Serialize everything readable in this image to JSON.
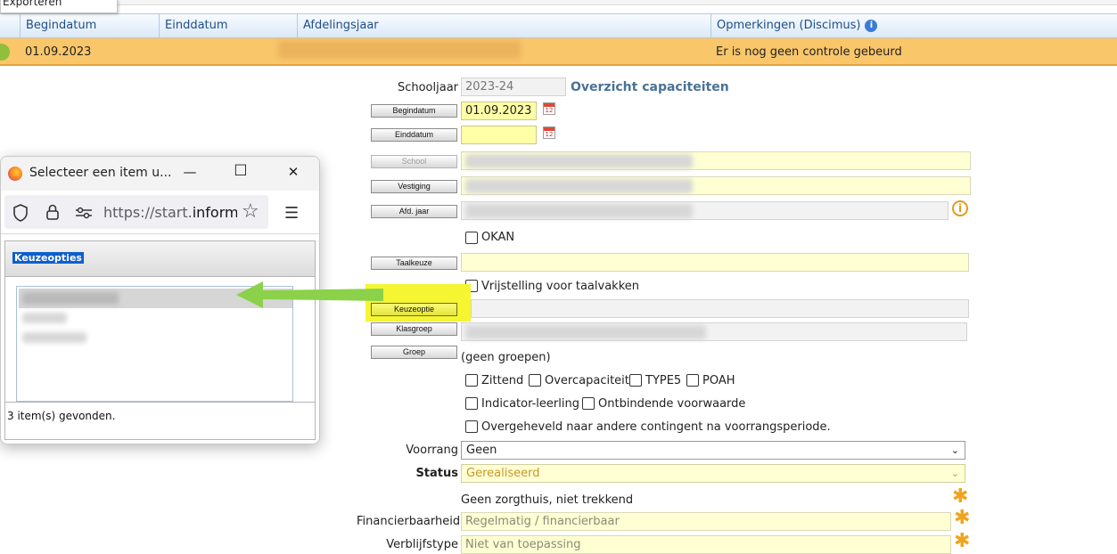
{
  "export_menu": {
    "item": "Exporteren"
  },
  "grid": {
    "columns": [
      "Begindatum",
      "Einddatum",
      "Afdelingsjaar",
      "Opmerkingen (Discimus)"
    ],
    "info_icon": "i",
    "row": {
      "begindatum": "01.09.2023",
      "einddatum": "",
      "opmerking": "Er is nog geen controle gebeurd"
    }
  },
  "form": {
    "schooljaar_label": "Schooljaar",
    "schooljaar_value": "2023-24",
    "overzicht_link": "Overzicht capaciteiten",
    "buttons": {
      "begindatum": "Begindatum",
      "einddatum": "Einddatum",
      "school": "School",
      "vestiging": "Vestiging",
      "afd_jaar": "Afd. jaar",
      "taalkeuze": "Taalkeuze",
      "keuzeoptie": "Keuzeoptie",
      "klasgroep": "Klasgroep",
      "groep": "Groep"
    },
    "begindatum_value": "01.09.2023",
    "einddatum_value": "",
    "cal_icon": "12",
    "okan_label": "OKAN",
    "vrijstelling_label": "Vrijstelling voor taalvakken",
    "geen_groepen": "(geen groepen)",
    "checkboxes_row1": [
      "Zittend",
      "Overcapaciteit",
      "TYPE5",
      "POAH"
    ],
    "checkboxes_row2": [
      "Indicator-leerling",
      "Ontbindende voorwaarde"
    ],
    "overgeheveld_label": "Overgeheveld naar andere contingent na voorrangsperiode.",
    "voorrang_label": "Voorrang",
    "voorrang_value": "Geen",
    "status_label": "Status",
    "status_value": "Gerealiseerd",
    "zorg_text": "Geen zorgthuis, niet trekkend",
    "financierbaarheid_label": "Financierbaarheid",
    "financierbaarheid_value": "Regelmatig / financierbaar",
    "verblijfstype_label": "Verblijfstype",
    "verblijfstype_value": "Niet van toepassing",
    "warn_icon": "i",
    "asterisk": "✱",
    "chevron": "⌄"
  },
  "popup": {
    "title": "Selecteer een item u...",
    "url_prefix": "https://start.",
    "url_domain": "informa",
    "min": "—",
    "max": "☐",
    "close": "✕",
    "panel_title": "Keuzeopties",
    "count_text": "3 item(s) gevonden.",
    "menu_icon": "☰",
    "star_icon": "☆"
  },
  "colors": {
    "row_highlight": "#f9c66a",
    "header_text": "#1f4e89",
    "field_yellow": "#ffffd3",
    "status_text": "#c8962a",
    "link": "#4a7296",
    "arrow": "#8bd14a"
  }
}
